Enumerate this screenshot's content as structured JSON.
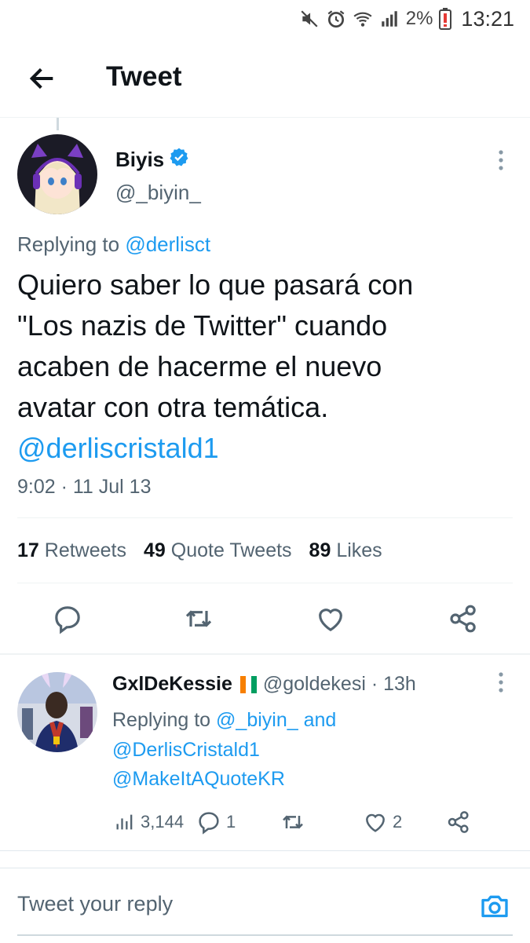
{
  "status_bar": {
    "battery": "2%",
    "time": "13:21"
  },
  "header": {
    "title": "Tweet"
  },
  "tweet": {
    "author_name": "Biyis",
    "author_handle": "@_biyin_",
    "replying_prefix": "Replying to",
    "replying_handle": "@derlisct",
    "text": "Quiero saber lo que pasará con\n\"Los nazis de Twitter\" cuando\nacaben de hacerme el nuevo\navatar con otra temática.",
    "mention": "@derliscristald1",
    "timestamp": "9:02 · 11 Jul 13",
    "stats": {
      "retweets_count": "17",
      "retweets_label": "Retweets",
      "quotes_count": "49",
      "quotes_label": "Quote Tweets",
      "likes_count": "89",
      "likes_label": "Likes"
    }
  },
  "reply": {
    "name": "GxlDeKessie",
    "handle_time": "@goldekesi · 13h",
    "replying_prefix": "Replying to",
    "replying_user": "@_biyin_ and",
    "replying_user2": "@DerlisCristald1",
    "mention": "@MakeItAQuoteKR",
    "views": "3,144",
    "replies": "1",
    "likes": "2"
  },
  "composer": {
    "placeholder": "Tweet your reply"
  },
  "colors": {
    "accent": "#1d9bf0",
    "muted": "#536471",
    "text": "#0f1419"
  }
}
